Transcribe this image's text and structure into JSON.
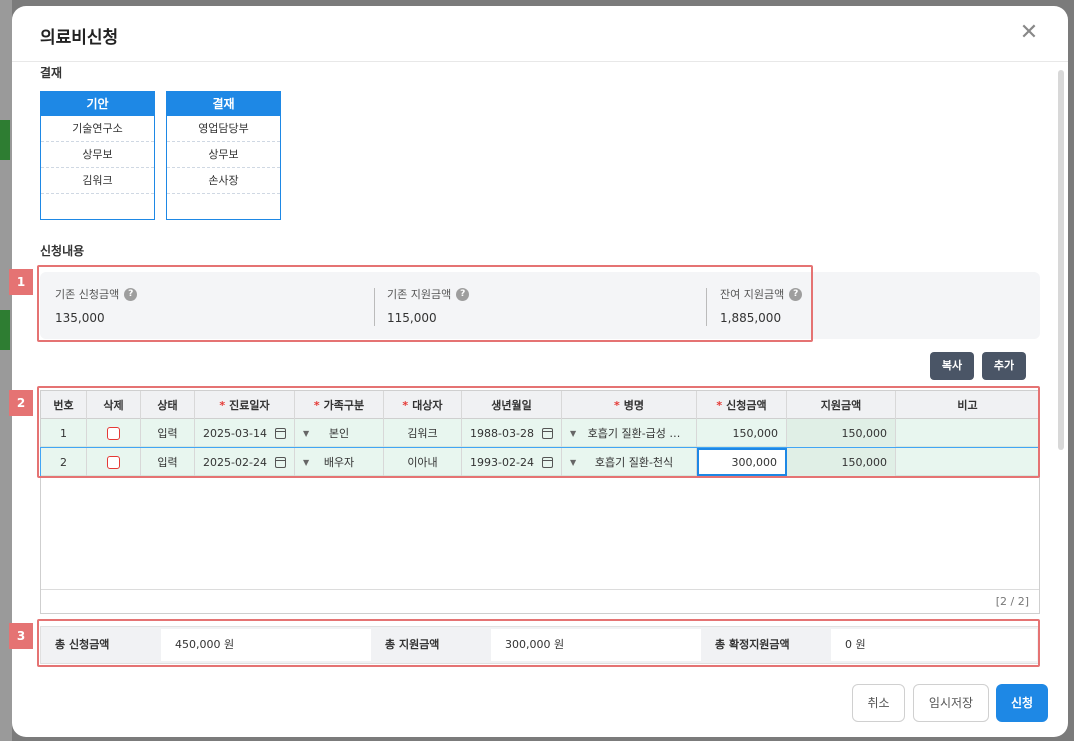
{
  "modal": {
    "title": "의료비신청",
    "close_label": "✕"
  },
  "approval": {
    "section_label": "결재",
    "boxes": [
      {
        "header": "기안",
        "rows": [
          "기술연구소",
          "상무보",
          "김워크",
          ""
        ]
      },
      {
        "header": "결재",
        "rows": [
          "영업담당부",
          "상무보",
          "손사장",
          ""
        ]
      }
    ]
  },
  "application": {
    "section_label": "신청내용",
    "summary": [
      {
        "label": "기존 신청금액",
        "value": "135,000"
      },
      {
        "label": "기존 지원금액",
        "value": "115,000"
      },
      {
        "label": "잔여 지원금액",
        "value": "1,885,000"
      }
    ]
  },
  "callouts": [
    "1",
    "2",
    "3"
  ],
  "buttons": {
    "copy": "복사",
    "add": "추가",
    "cancel": "취소",
    "temp_save": "임시저장",
    "submit": "신청"
  },
  "grid": {
    "columns": [
      {
        "label": "번호",
        "required": false
      },
      {
        "label": "삭제",
        "required": false
      },
      {
        "label": "상태",
        "required": false
      },
      {
        "label": "진료일자",
        "required": true
      },
      {
        "label": "가족구분",
        "required": true
      },
      {
        "label": "대상자",
        "required": true
      },
      {
        "label": "생년월일",
        "required": false
      },
      {
        "label": "병명",
        "required": true
      },
      {
        "label": "신청금액",
        "required": true
      },
      {
        "label": "지원금액",
        "required": false
      },
      {
        "label": "비고",
        "required": false
      }
    ],
    "required_mark": "*",
    "rows": [
      {
        "no": "1",
        "status": "입력",
        "date": "2025-03-14",
        "family": "본인",
        "target": "김워크",
        "birth": "1988-03-28",
        "disease": "호흡기 질환-급성 …",
        "request": "150,000",
        "support": "150,000",
        "note": ""
      },
      {
        "no": "2",
        "status": "입력",
        "date": "2025-02-24",
        "family": "배우자",
        "target": "이아내",
        "birth": "1993-02-24",
        "disease": "호흡기 질환-천식",
        "request": "300,000",
        "support": "150,000",
        "note": ""
      }
    ],
    "pager": "[2 / 2]"
  },
  "totals": [
    {
      "label": "총 신청금액",
      "value": "450,000 원"
    },
    {
      "label": "총 지원금액",
      "value": "300,000 원"
    },
    {
      "label": "총 확정지원금액",
      "value": "0 원"
    }
  ]
}
